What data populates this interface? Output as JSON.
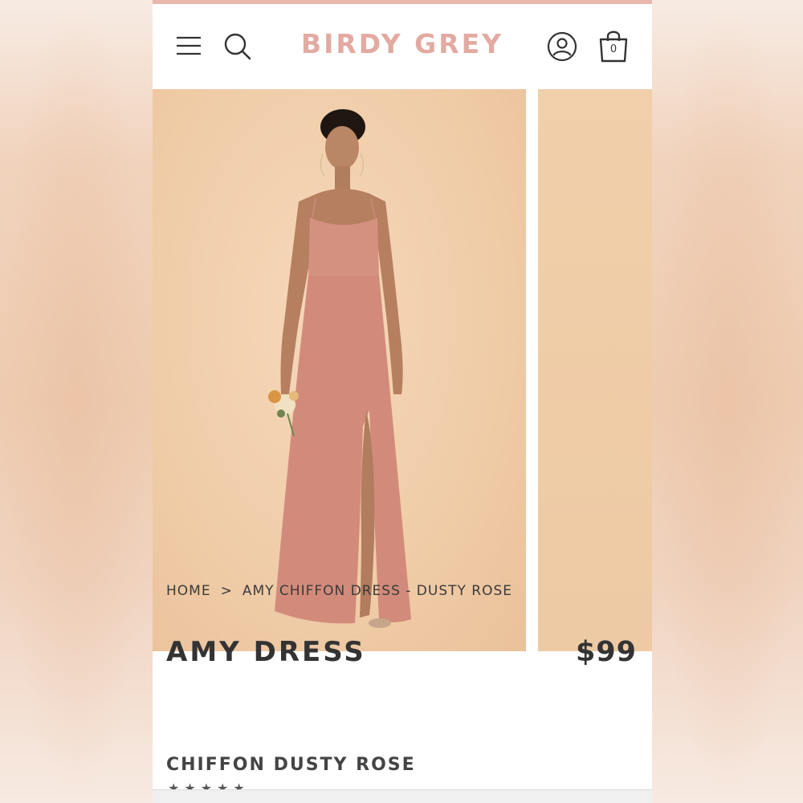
{
  "brand": {
    "logo_text": "BIRDY GREY",
    "accent_color": "#e3aaa2"
  },
  "header": {
    "icons": [
      "menu-icon",
      "search-icon",
      "account-icon",
      "cart-icon"
    ],
    "cart_count": "0"
  },
  "gallery": {
    "main_image": "model wearing dusty rose chiffon slip dress holding flower bouquet",
    "background_color": "#f0cda9",
    "dress_color": "#d98e7d"
  },
  "breadcrumb": {
    "home": "HOME",
    "separator": ">",
    "current": "AMY CHIFFON DRESS - DUSTY ROSE"
  },
  "product": {
    "name": "AMY DRESS",
    "subtitle": "CHIFFON DUSTY ROSE",
    "price": "$99",
    "rating_stars": "★★★★★"
  }
}
